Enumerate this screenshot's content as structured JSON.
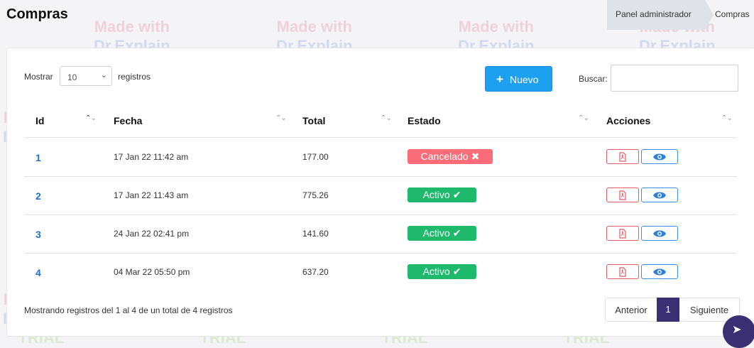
{
  "header": {
    "title": "Compras",
    "breadcrumb": [
      "Panel administrador",
      "Compras"
    ]
  },
  "controls": {
    "show_label": "Mostrar",
    "page_size": "10",
    "records_label": "registros",
    "new_button": "Nuevo",
    "search_label": "Buscar:",
    "search_value": ""
  },
  "table": {
    "columns": [
      "Id",
      "Fecha",
      "Total",
      "Estado",
      "Acciones"
    ],
    "rows": [
      {
        "id": "1",
        "fecha": "17 Jan 22 11:42 am",
        "total": "177.00",
        "estado": "Cancelado",
        "estado_type": "cancel"
      },
      {
        "id": "2",
        "fecha": "17 Jan 22 11:43 am",
        "total": "775.26",
        "estado": "Activo",
        "estado_type": "active"
      },
      {
        "id": "3",
        "fecha": "24 Jan 22 02:41 pm",
        "total": "141.60",
        "estado": "Activo",
        "estado_type": "active"
      },
      {
        "id": "4",
        "fecha": "04 Mar 22 05:50 pm",
        "total": "637.20",
        "estado": "Activo",
        "estado_type": "active"
      }
    ]
  },
  "footer": {
    "info": "Mostrando registros del 1 al 4 de un total de 4 registros",
    "prev": "Anterior",
    "current_page": "1",
    "next": "Siguiente"
  },
  "watermark": [
    "Made with",
    "Dr.Explain",
    "TRIAL"
  ],
  "colors": {
    "primary": "#1ea0f0",
    "cancel": "#fc6b78",
    "active": "#1fb96c",
    "pager_active": "#3a2f73",
    "link": "#1f6fd6"
  }
}
